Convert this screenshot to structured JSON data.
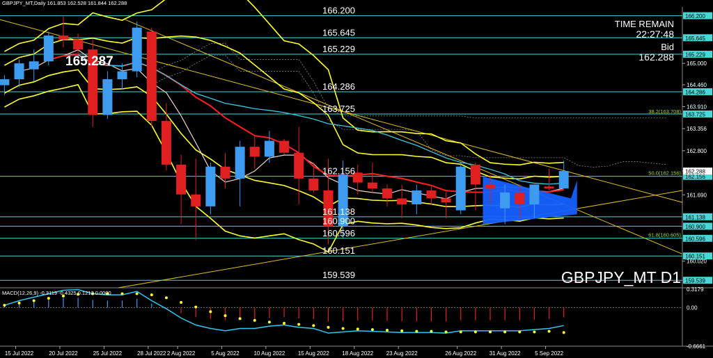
{
  "header": {
    "text": "GBPJPY_MT,Daily  161.853 162.528 161.844 162.288"
  },
  "overlay": {
    "time_remain_label": "TIME REMAIN",
    "time_remain_value": "22:27:48",
    "bid_label": "Bid",
    "bid_value": "162.288",
    "big_price": "165.287",
    "symbol_tf": "GBPJPY_MT D1"
  },
  "macd_header": "MACD(12,26,9) -0.3119 -0.4325 0.1212 0.0000",
  "chart_data": [
    {
      "type": "candlestick",
      "name": "GBPJPY_MT,Daily",
      "x": [
        "14 Jul",
        "15 Jul",
        "18 Jul",
        "19 Jul",
        "20 Jul",
        "21 Jul",
        "22 Jul",
        "25 Jul",
        "26 Jul",
        "27 Jul",
        "28 Jul",
        "29 Jul",
        "1 Aug",
        "2 Aug",
        "3 Aug",
        "4 Aug",
        "5 Aug",
        "8 Aug",
        "9 Aug",
        "10 Aug",
        "11 Aug",
        "12 Aug",
        "15 Aug",
        "16 Aug",
        "17 Aug",
        "18 Aug",
        "19 Aug",
        "22 Aug",
        "23 Aug",
        "24 Aug",
        "25 Aug",
        "26 Aug",
        "29 Aug",
        "30 Aug",
        "31 Aug",
        "1 Sep",
        "2 Sep",
        "5 Sep",
        "6 Sep"
      ],
      "x_tick_labels": [
        "15 Jul 2022",
        "20 Jul 2022",
        "25 Jul 2022",
        "28 Jul 2022",
        "2 Aug 2022",
        "5 Aug 2022",
        "10 Aug 2022",
        "15 Aug 2022",
        "18 Aug 2022",
        "23 Aug 2022",
        "26 Aug 2022",
        "31 Aug 2022",
        "5 Sep 2022"
      ],
      "ohlc": [
        [
          164.45,
          164.7,
          164.2,
          164.6
        ],
        [
          164.6,
          165.1,
          164.4,
          165.0
        ],
        [
          164.85,
          165.35,
          164.55,
          165.05
        ],
        [
          165.05,
          165.8,
          164.95,
          165.7
        ],
        [
          165.7,
          166.2,
          165.4,
          165.6
        ],
        [
          165.6,
          165.75,
          165.0,
          165.35
        ],
        [
          165.35,
          165.6,
          163.4,
          163.7
        ],
        [
          163.7,
          164.8,
          163.6,
          164.6
        ],
        [
          164.6,
          165.0,
          164.35,
          164.8
        ],
        [
          164.8,
          166.05,
          164.65,
          165.9
        ],
        [
          165.8,
          165.9,
          163.4,
          163.55
        ],
        [
          163.55,
          164.0,
          162.3,
          162.45
        ],
        [
          162.45,
          162.7,
          160.95,
          161.7
        ],
        [
          161.7,
          162.6,
          160.55,
          161.4
        ],
        [
          161.4,
          162.5,
          161.2,
          162.4
        ],
        [
          162.4,
          162.75,
          161.85,
          162.1
        ],
        [
          162.1,
          163.05,
          161.4,
          162.9
        ],
        [
          162.9,
          163.2,
          162.35,
          162.65
        ],
        [
          162.65,
          163.3,
          162.5,
          163.05
        ],
        [
          163.05,
          163.1,
          162.7,
          162.75
        ],
        [
          162.75,
          163.4,
          161.45,
          162.1
        ],
        [
          162.1,
          162.5,
          161.75,
          161.8
        ],
        [
          161.8,
          162.6,
          160.45,
          160.9
        ],
        [
          160.9,
          162.55,
          160.6,
          162.2
        ],
        [
          162.25,
          162.45,
          161.7,
          162.0
        ],
        [
          162.0,
          162.5,
          161.75,
          161.85
        ],
        [
          161.85,
          161.95,
          161.4,
          161.6
        ],
        [
          161.6,
          161.95,
          161.1,
          161.45
        ],
        [
          161.45,
          161.95,
          161.2,
          161.8
        ],
        [
          161.8,
          161.9,
          161.45,
          161.6
        ],
        [
          161.6,
          161.75,
          161.1,
          161.5
        ],
        [
          161.3,
          162.5,
          161.2,
          162.4
        ],
        [
          162.45,
          162.5,
          161.3,
          161.95
        ],
        [
          161.95,
          162.2,
          161.45,
          161.85
        ],
        [
          161.35,
          161.95,
          160.95,
          161.75
        ],
        [
          161.75,
          161.95,
          161.1,
          161.45
        ],
        [
          161.45,
          161.95,
          161.1,
          161.95
        ],
        [
          161.9,
          162.35,
          161.8,
          161.85
        ],
        [
          161.85,
          162.55,
          161.85,
          162.29
        ]
      ]
    },
    {
      "type": "line",
      "name": "price_axis",
      "y_tick_labels": [
        "166.20",
        "165.645",
        "165.229",
        "165.000",
        "164.460",
        "164.286",
        "163.910",
        "163.725",
        "163.356",
        "162.800",
        "162.288",
        "162.156",
        "161.690",
        "161.138",
        "160.900",
        "160.596",
        "160.151",
        "160.020",
        "159.539"
      ],
      "ylim": [
        159.35,
        166.42
      ]
    },
    {
      "type": "line",
      "name": "horizontal_levels",
      "levels": [
        166.2,
        165.645,
        165.229,
        164.286,
        163.725,
        162.156,
        161.138,
        160.9,
        160.596,
        160.151,
        159.539
      ],
      "fib_labels": [
        "38.2(163.708)",
        "50.0(162.156)",
        "61.8(160.605)"
      ]
    },
    {
      "type": "bar",
      "name": "MACD(12,26,9)",
      "y_tick_labels": [
        "0.3179",
        "0.00",
        "-0.6661"
      ],
      "ylim": [
        -0.6661,
        0.3179
      ],
      "histogram": [
        0.04,
        0.12,
        0.18,
        0.24,
        0.3,
        0.31,
        0.24,
        0.22,
        0.22,
        0.28,
        0.12,
        -0.02,
        -0.18,
        -0.3,
        -0.36,
        -0.4,
        -0.36,
        -0.36,
        -0.32,
        -0.3,
        -0.34,
        -0.36,
        -0.44,
        -0.42,
        -0.4,
        -0.41,
        -0.42,
        -0.43,
        -0.43,
        -0.43,
        -0.44,
        -0.4,
        -0.4,
        -0.4,
        -0.4,
        -0.4,
        -0.38,
        -0.36,
        -0.31
      ],
      "signal": [
        0.04,
        0.08,
        0.12,
        0.16,
        0.2,
        0.23,
        0.24,
        0.24,
        0.24,
        0.24,
        0.22,
        0.17,
        0.09,
        0.01,
        -0.07,
        -0.14,
        -0.19,
        -0.22,
        -0.25,
        -0.27,
        -0.29,
        -0.31,
        -0.34,
        -0.36,
        -0.37,
        -0.38,
        -0.39,
        -0.4,
        -0.41,
        -0.41,
        -0.42,
        -0.42,
        -0.42,
        -0.42,
        -0.42,
        -0.42,
        -0.42,
        -0.41,
        -0.43
      ]
    }
  ],
  "colors": {
    "bull": "#3d9cf0",
    "bear": "#e02020",
    "level_line": "#47d7d7",
    "channel": "#ffff33",
    "ma_red": "#ff2020",
    "ma_cyan": "#40c8e0",
    "trendline": "#e0c020",
    "triangle": "#1560ff"
  }
}
